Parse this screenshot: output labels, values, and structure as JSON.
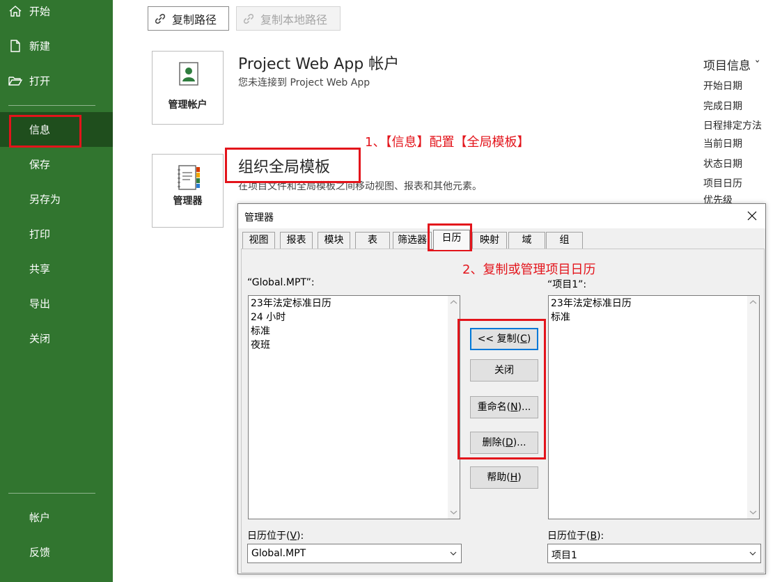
{
  "sidebar": {
    "items": [
      {
        "label": "开始",
        "icon": "home-icon"
      },
      {
        "label": "新建",
        "icon": "new-file-icon"
      },
      {
        "label": "打开",
        "icon": "open-folder-icon"
      },
      {
        "label": "信息",
        "active": true
      },
      {
        "label": "保存"
      },
      {
        "label": "另存为"
      },
      {
        "label": "打印"
      },
      {
        "label": "共享"
      },
      {
        "label": "导出"
      },
      {
        "label": "关闭"
      }
    ],
    "bottom_items": [
      {
        "label": "帐户"
      },
      {
        "label": "反馈"
      }
    ],
    "colors": {
      "background": "#31752f",
      "active": "#1f4e1d"
    }
  },
  "toolbar": {
    "copy_path": "复制路径",
    "copy_local_path": "复制本地路径"
  },
  "account_section": {
    "tile_label": "管理帐户",
    "title": "Project Web App 帐户",
    "description": "您未连接到 Project Web App"
  },
  "organizer_section": {
    "tile_label": "管理器",
    "title": "组织全局模板",
    "description": "在项目文件和全局模板之间移动视图、报表和其他元素。"
  },
  "project_info": {
    "heading": "项目信息 ˇ",
    "fields": [
      "开始日期",
      "完成日期",
      "日程排定方法",
      "当前日期",
      "状态日期",
      "项目日历",
      "优先级"
    ]
  },
  "annotations": {
    "step1": "1、【信息】配置【全局模板】",
    "step2": "2、复制或管理项目日历",
    "color": "#e3141b"
  },
  "dialog": {
    "title": "管理器",
    "tabs": [
      "视图",
      "报表",
      "模块",
      "表",
      "筛选器",
      "日历",
      "映射",
      "域",
      "组"
    ],
    "selected_tab": "日历",
    "left_label": "“Global.MPT”:",
    "left_items": [
      "23年法定标准日历",
      "24 小时",
      "标准",
      "夜班"
    ],
    "right_label": "“项目1”:",
    "right_items": [
      "23年法定标准日历",
      "标准"
    ],
    "buttons": {
      "copy": {
        "pre": "<< 复制(",
        "key": "C",
        "post": ")"
      },
      "close": "关闭",
      "rename": {
        "pre": "重命名(",
        "key": "N",
        "post": ")..."
      },
      "delete": {
        "pre": "删除(",
        "key": "D",
        "post": ")..."
      },
      "help": {
        "pre": "帮助(",
        "key": "H",
        "post": ")"
      }
    },
    "left_location": {
      "pre": "日历位于(",
      "key": "V",
      "post": "):",
      "value": "Global.MPT"
    },
    "right_location": {
      "pre": "日历位于(",
      "key": "B",
      "post": "):",
      "value": "项目1"
    }
  }
}
